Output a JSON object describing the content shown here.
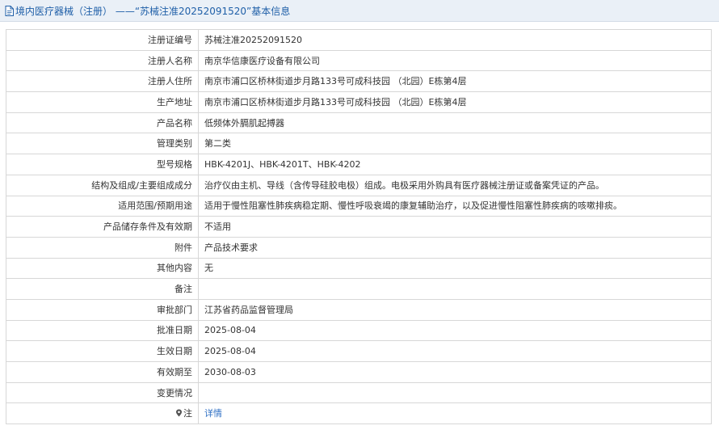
{
  "header": {
    "title": "境内医疗器械（注册） ——“苏械注准20252091520”基本信息",
    "icon": "document-icon"
  },
  "rows": [
    {
      "name": "registration-number",
      "label": "注册证编号",
      "value": "苏械注准20252091520"
    },
    {
      "name": "registrant-name",
      "label": "注册人名称",
      "value": "南京华信康医疗设备有限公司"
    },
    {
      "name": "registrant-address",
      "label": "注册人住所",
      "value": "南京市浦口区桥林街道步月路133号可成科技园 （北园）E栋第4层"
    },
    {
      "name": "production-address",
      "label": "生产地址",
      "value": "南京市浦口区桥林街道步月路133号可成科技园 （北园）E栋第4层"
    },
    {
      "name": "product-name",
      "label": "产品名称",
      "value": "低频体外膈肌起搏器"
    },
    {
      "name": "management-category",
      "label": "管理类别",
      "value": "第二类"
    },
    {
      "name": "model-spec",
      "label": "型号规格",
      "value": "HBK-4201J、HBK-4201T、HBK-4202"
    },
    {
      "name": "structure-composition",
      "label": "结构及组成/主要组成成分",
      "value": "治疗仪由主机、导线（含传导硅胶电极）组成。电极采用外购具有医疗器械注册证或备案凭证的产品。"
    },
    {
      "name": "scope-of-use",
      "label": "适用范围/预期用途",
      "value": "适用于慢性阻塞性肺疾病稳定期、慢性呼吸衰竭的康复辅助治疗，以及促进慢性阻塞性肺疾病的咳嗽排痰。"
    },
    {
      "name": "storage-conditions",
      "label": "产品储存条件及有效期",
      "value": "不适用"
    },
    {
      "name": "attachment",
      "label": "附件",
      "value": "产品技术要求"
    },
    {
      "name": "other-content",
      "label": "其他内容",
      "value": "无"
    },
    {
      "name": "remarks",
      "label": "备注",
      "value": ""
    },
    {
      "name": "approval-department",
      "label": "审批部门",
      "value": "江苏省药品监督管理局"
    },
    {
      "name": "approval-date",
      "label": "批准日期",
      "value": "2025-08-04"
    },
    {
      "name": "effective-date",
      "label": "生效日期",
      "value": "2025-08-04"
    },
    {
      "name": "expiry-date",
      "label": "有效期至",
      "value": "2030-08-03"
    },
    {
      "name": "change-info",
      "label": "变更情况",
      "value": ""
    }
  ],
  "note_row": {
    "label": "注",
    "icon": "pin-icon",
    "link_text": "详情",
    "link_color": "#2e6fc4"
  },
  "colors": {
    "header_bg": "#eaf0f7",
    "header_text": "#1f5fa8",
    "border": "#d7d7d7"
  }
}
